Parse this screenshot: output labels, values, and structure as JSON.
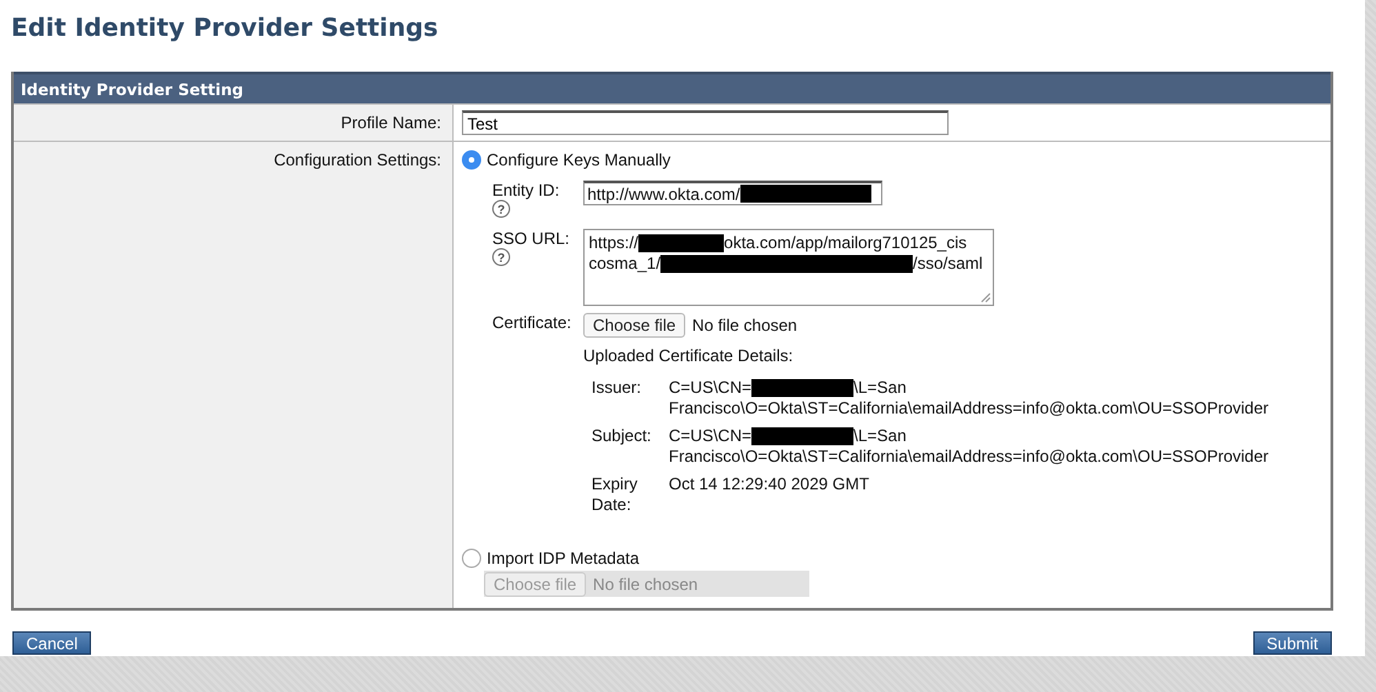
{
  "page_title": "Edit Identity Provider Settings",
  "panel": {
    "title": "Identity Provider Setting",
    "profile_name": {
      "label": "Profile Name:",
      "value": "Test"
    },
    "configuration": {
      "label": "Configuration Settings:",
      "options": [
        {
          "label": "Configure Keys Manually",
          "selected": true
        },
        {
          "label": "Import IDP Metadata",
          "selected": false
        }
      ],
      "entity_id": {
        "label": "Entity ID:",
        "help": "?",
        "segments": [
          {
            "kind": "text",
            "text": "http://www.okta.com/"
          },
          {
            "kind": "redacted"
          }
        ]
      },
      "sso_url": {
        "label": "SSO URL:",
        "help": "?",
        "lines": [
          [
            {
              "kind": "text",
              "text": "https://"
            },
            {
              "kind": "redacted"
            },
            {
              "kind": "text",
              "text": "okta.com/app/mailorg710125_cis"
            }
          ],
          [
            {
              "kind": "text",
              "text": "cosma_1/"
            },
            {
              "kind": "redacted"
            },
            {
              "kind": "text",
              "text": "/sso/saml"
            }
          ]
        ]
      },
      "certificate": {
        "label": "Certificate:",
        "button": "Choose file",
        "status": "No file chosen",
        "disabled": false
      },
      "cert_details": {
        "title": "Uploaded Certificate Details:",
        "rows": [
          {
            "label": "Issuer:",
            "lines": [
              [
                {
                  "kind": "text",
                  "text": "C=US\\CN="
                },
                {
                  "kind": "redacted"
                },
                {
                  "kind": "text",
                  "text": "\\L=San"
                }
              ],
              [
                {
                  "kind": "text",
                  "text": "Francisco\\O=Okta\\ST=California\\emailAddress=info@okta.com\\OU=SSOProvider"
                }
              ]
            ]
          },
          {
            "label": "Subject:",
            "lines": [
              [
                {
                  "kind": "text",
                  "text": "C=US\\CN="
                },
                {
                  "kind": "redacted"
                },
                {
                  "kind": "text",
                  "text": "\\L=San"
                }
              ],
              [
                {
                  "kind": "text",
                  "text": "Francisco\\O=Okta\\ST=California\\emailAddress=info@okta.com\\OU=SSOProvider"
                }
              ]
            ]
          },
          {
            "label": "Expiry Date:",
            "lines": [
              [
                {
                  "kind": "text",
                  "text": "Oct 14 12:29:40 2029 GMT"
                }
              ]
            ]
          }
        ]
      },
      "metadata_file": {
        "button": "Choose file",
        "status": "No file chosen",
        "disabled": true
      }
    }
  },
  "buttons": [
    {
      "label": "Cancel"
    },
    {
      "label": "Submit"
    }
  ]
}
